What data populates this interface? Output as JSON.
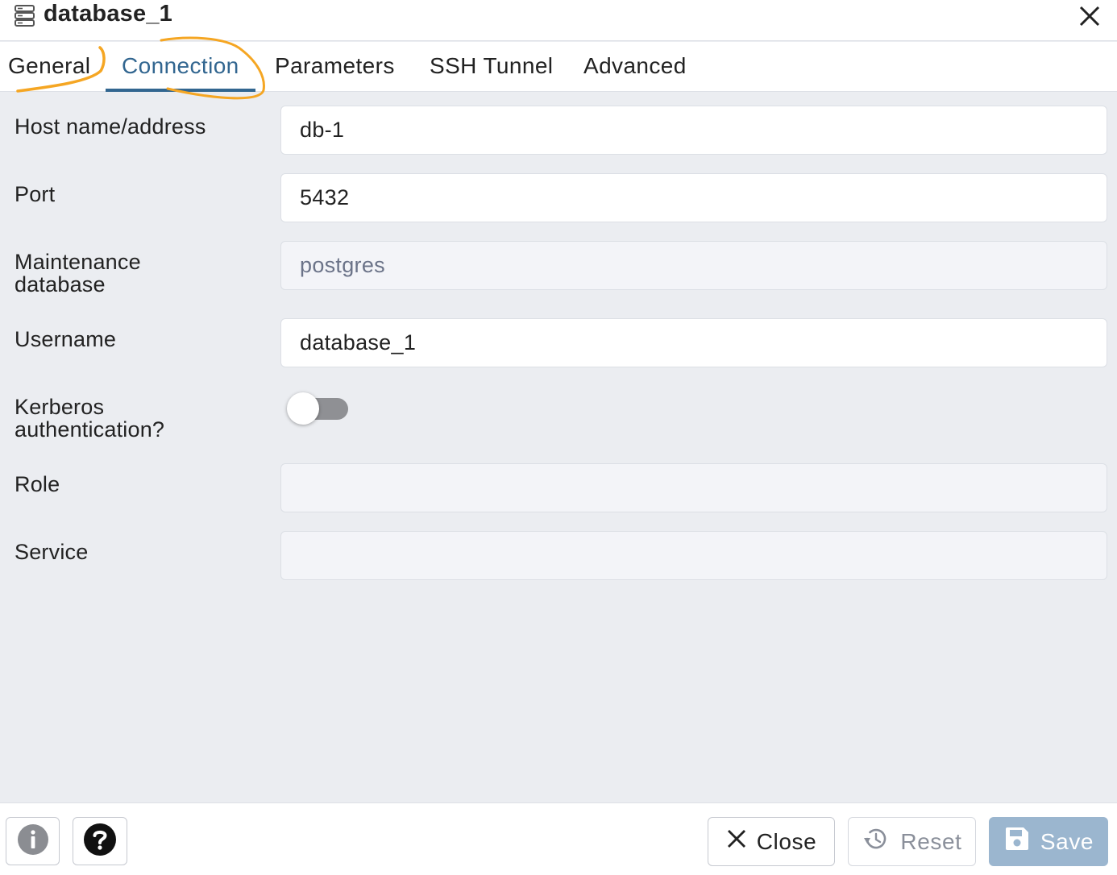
{
  "window": {
    "title": "database_1",
    "icon": "server-icon",
    "close_icon": "close-icon"
  },
  "tabs": [
    {
      "label": "General",
      "active": false
    },
    {
      "label": "Connection",
      "active": true
    },
    {
      "label": "Parameters",
      "active": false
    },
    {
      "label": "SSH Tunnel",
      "active": false
    },
    {
      "label": "Advanced",
      "active": false
    }
  ],
  "form": {
    "host": {
      "label": "Host name/address",
      "value": "db-1"
    },
    "port": {
      "label": "Port",
      "value": "5432"
    },
    "maintenance_db": {
      "label_line1": "Maintenance",
      "label_line2": "database",
      "value": "postgres",
      "disabled": true
    },
    "username": {
      "label": "Username",
      "value": "database_1"
    },
    "kerberos": {
      "label_line1": "Kerberos",
      "label_line2": "authentication?",
      "enabled": false
    },
    "role": {
      "label": "Role",
      "value": ""
    },
    "service": {
      "label": "Service",
      "value": ""
    }
  },
  "footer": {
    "info_icon": "info-icon",
    "help_icon": "help-icon",
    "close_label": "Close",
    "reset_label": "Reset",
    "save_label": "Save"
  },
  "colors": {
    "accent": "#326690",
    "annotation": "#f5a623",
    "save_button": "#9bb6cf",
    "background": "#ebedf1"
  }
}
